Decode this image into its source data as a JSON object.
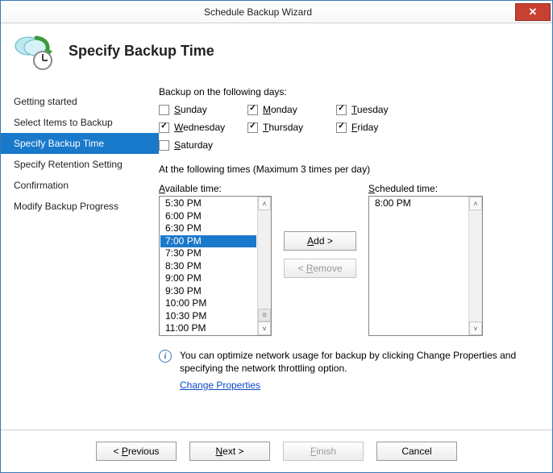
{
  "window": {
    "title": "Schedule Backup Wizard"
  },
  "header": {
    "page_title": "Specify Backup Time"
  },
  "sidebar": {
    "items": [
      {
        "label": "Getting started",
        "selected": false
      },
      {
        "label": "Select Items to Backup",
        "selected": false
      },
      {
        "label": "Specify Backup Time",
        "selected": true
      },
      {
        "label": "Specify Retention Setting",
        "selected": false
      },
      {
        "label": "Confirmation",
        "selected": false
      },
      {
        "label": "Modify Backup Progress",
        "selected": false
      }
    ]
  },
  "main": {
    "days_label": "Backup on the following days:",
    "days": [
      {
        "letter": "S",
        "rest": "unday",
        "checked": false
      },
      {
        "letter": "M",
        "rest": "onday",
        "checked": true
      },
      {
        "letter": "T",
        "rest": "uesday",
        "checked": true
      },
      {
        "letter": "W",
        "rest": "ednesday",
        "checked": true
      },
      {
        "letter": "T",
        "rest": "hursday",
        "checked": true
      },
      {
        "letter": "F",
        "rest": "riday",
        "checked": true
      },
      {
        "letter": "S",
        "rest": "aturday",
        "checked": false
      }
    ],
    "times_label": "At the following times (Maximum 3 times per day)",
    "available_caption_letter": "A",
    "available_caption_rest": "vailable time:",
    "scheduled_caption_letter": "S",
    "scheduled_caption_rest": "cheduled time:",
    "available_times": [
      "5:30 PM",
      "6:00 PM",
      "6:30 PM",
      "7:00 PM",
      "7:30 PM",
      "8:30 PM",
      "9:00 PM",
      "9:30 PM",
      "10:00 PM",
      "10:30 PM",
      "11:00 PM"
    ],
    "available_selected_index": 3,
    "scheduled_times": [
      "8:00 PM"
    ],
    "add_label_u": "A",
    "add_label_rest": "dd >",
    "remove_label_pre": "< ",
    "remove_label_u": "R",
    "remove_label_rest": "emove",
    "info_text": "You can optimize network usage for backup by clicking Change Properties and specifying the network throttling option.",
    "link_text": "Change Properties"
  },
  "footer": {
    "previous_pre": "< ",
    "previous_u": "P",
    "previous_rest": "revious",
    "next_u": "N",
    "next_rest": "ext >",
    "finish_u": "F",
    "finish_rest": "inish",
    "cancel": "Cancel"
  }
}
